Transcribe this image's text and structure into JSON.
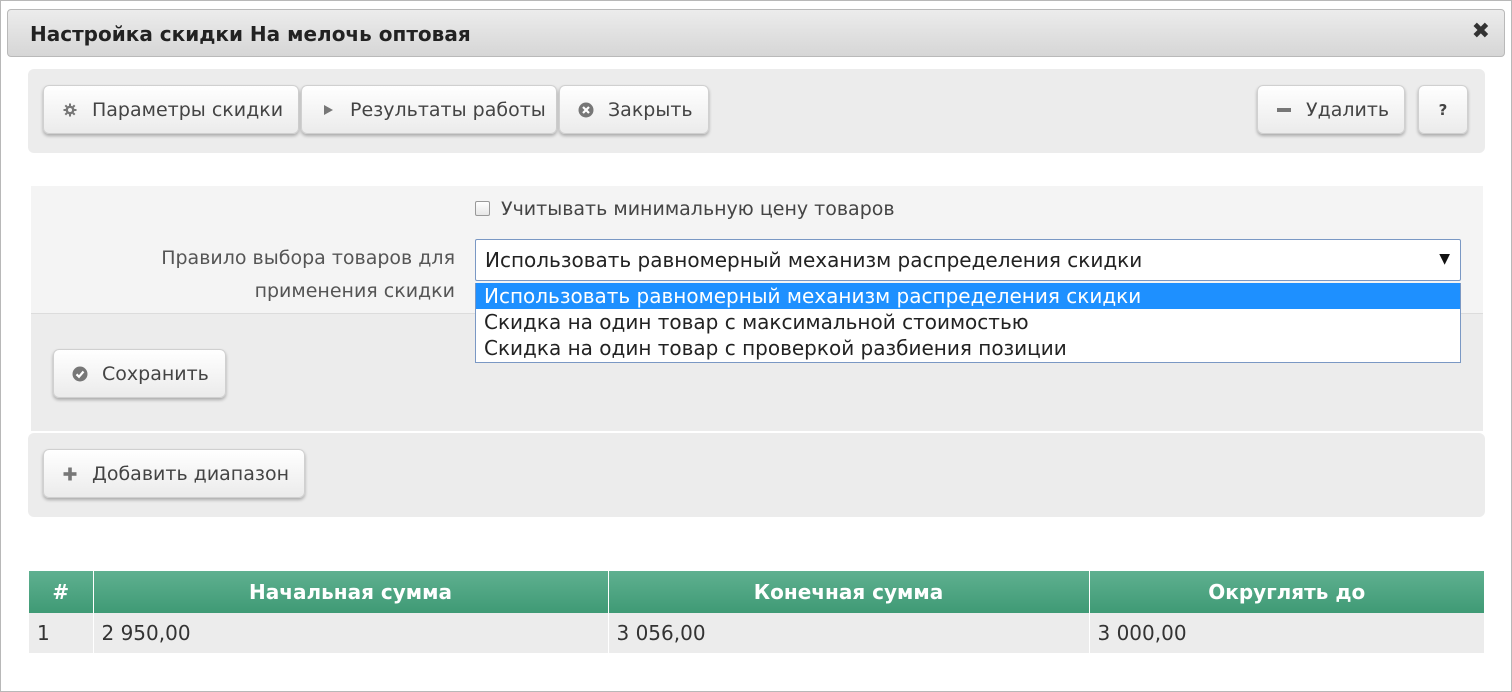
{
  "window": {
    "title": "Настройка скидки На мелочь оптовая",
    "close_icon": "✖"
  },
  "toolbar": {
    "params_label": "Параметры скидки",
    "results_label": "Результаты работы",
    "close_label": "Закрыть",
    "delete_label": "Удалить",
    "help_label": "?"
  },
  "form": {
    "min_price_label": "Учитывать минимальную цену товаров",
    "min_price_checked": false,
    "rule_label": "Правило выбора товаров для применения скидки",
    "rule_selected": "Использовать равномерный механизм распределения скидки",
    "rule_options": [
      "Использовать равномерный механизм распределения скидки",
      "Скидка на один товар с максимальной стоимостью",
      "Скидка на один товар с проверкой разбиения позиции"
    ],
    "save_label": "Сохранить"
  },
  "ranges": {
    "add_label": "Добавить диапазон"
  },
  "table": {
    "columns": [
      "#",
      "Начальная сумма",
      "Конечная сумма",
      "Округлять до"
    ],
    "rows": [
      [
        "1",
        "2 950,00",
        "3 056,00",
        "3 000,00"
      ]
    ]
  },
  "colors": {
    "header_green": "#4fa883",
    "select_highlight": "#1e90ff"
  }
}
